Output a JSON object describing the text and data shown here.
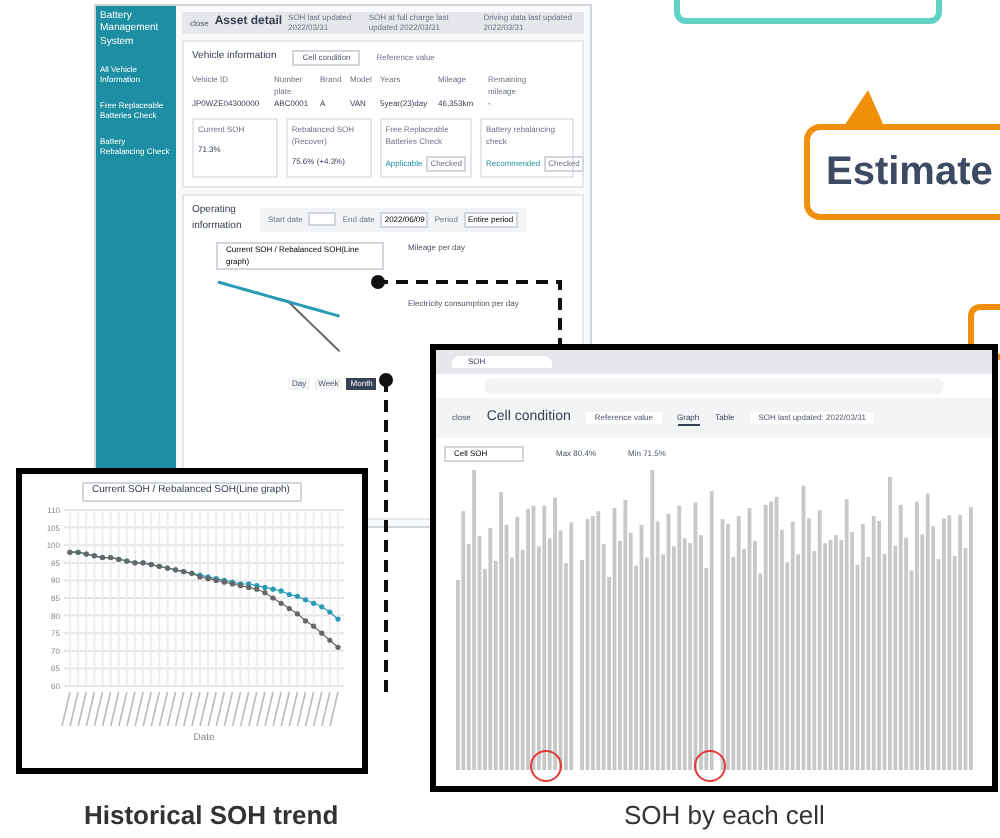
{
  "app": {
    "title": "Battery Management System",
    "nav": [
      {
        "label": "All Vehicle Information",
        "selected": false
      },
      {
        "label": "Free Replaceable Batteries Check",
        "selected": false
      },
      {
        "label": "Battery Rebalancing Check",
        "selected": false
      }
    ]
  },
  "asset": {
    "back": "close",
    "title": "Asset detail",
    "updates": [
      "SOH last updated 2022/03/31",
      "SOH at full charge last updated 2022/03/31",
      "Driving data last updated 2022/03/31"
    ],
    "vehicle": {
      "heading": "Vehicle information",
      "cell_button": "Cell condition",
      "reference": "Reference value",
      "fields": [
        {
          "label": "Vehicle ID",
          "value": "JP0WZE04300000"
        },
        {
          "label": "Number plate",
          "value": "ABC0001"
        },
        {
          "label": "Brand",
          "value": "A"
        },
        {
          "label": "Model",
          "value": "VAN"
        },
        {
          "label": "Years",
          "value": "5year(23)day"
        },
        {
          "label": "Mileage",
          "value": "46,353km"
        },
        {
          "label": "Remaining mileage",
          "value": "-"
        }
      ],
      "cards": [
        {
          "label": "Current SOH",
          "value": "71.3%"
        },
        {
          "label": "Rebalanced SOH (Recover)",
          "value": "75.6% (+4.3%)"
        },
        {
          "label": "Free Replaceable Batteries Check",
          "value": "Applicable",
          "check": "Checked"
        },
        {
          "label": "Battery rebalancing check",
          "value": "Recommended",
          "check": "Checked"
        }
      ]
    },
    "operating": {
      "heading": "Operating information",
      "start": "Start date",
      "end": "End date",
      "end_value": "2022/06/09",
      "period": "Period",
      "period_value": "Entire period",
      "graph_select": "Current SOH / Rebalanced SOH(Line graph)",
      "mileage": "Mileage per day",
      "electricity": "Electricity consumption per day",
      "ranges": [
        {
          "label": "Day",
          "selected": false
        },
        {
          "label": "Week",
          "selected": false
        },
        {
          "label": "Month",
          "selected": true
        }
      ]
    }
  },
  "callouts": [
    {
      "kind": "teal"
    },
    {
      "kind": "orange",
      "text": "Estimate"
    },
    {
      "kind": "orange-small"
    }
  ],
  "trend": {
    "select": "Current SOH / Rebalanced SOH(Line graph)",
    "caption": "Historical SOH trend",
    "chart_data": {
      "type": "line",
      "xlabel": "Date",
      "grid": true,
      "ylim": [
        60,
        110
      ],
      "yticks": [
        60,
        65,
        70,
        75,
        80,
        85,
        90,
        95,
        100,
        105,
        110
      ],
      "series": [
        {
          "color": "#2a9bb5",
          "values": [
            98,
            98,
            97.5,
            97,
            96.5,
            96.5,
            96,
            95.5,
            95,
            95,
            94.5,
            94,
            93.5,
            93,
            92.5,
            92,
            91.5,
            91,
            90.5,
            90,
            89.5,
            89,
            89,
            88.5,
            88,
            87.5,
            87,
            86,
            85.5,
            84.5,
            83.5,
            82.5,
            81,
            79
          ]
        },
        {
          "color": "#666666",
          "values": [
            98,
            98,
            97.5,
            97,
            96.5,
            96.5,
            96,
            95.5,
            95,
            95,
            94.5,
            94,
            93.5,
            93,
            92.5,
            92,
            91,
            90.5,
            90,
            89.5,
            89,
            88.5,
            88,
            87.5,
            86.5,
            85,
            83.5,
            82,
            80.5,
            78.5,
            77,
            75,
            73,
            71
          ]
        }
      ]
    }
  },
  "cell": {
    "tab": "SOH",
    "window_title": "Cell condition",
    "back": "close",
    "reference": "Reference value",
    "views": [
      {
        "label": "Graph",
        "selected": true
      },
      {
        "label": "Table",
        "selected": false
      }
    ],
    "updated": "SOH last updated: 2022/03/31",
    "select": "Cell SOH",
    "max": "Max 80.4%",
    "min": "Min 71.5%",
    "caption": "SOH by each cell"
  }
}
